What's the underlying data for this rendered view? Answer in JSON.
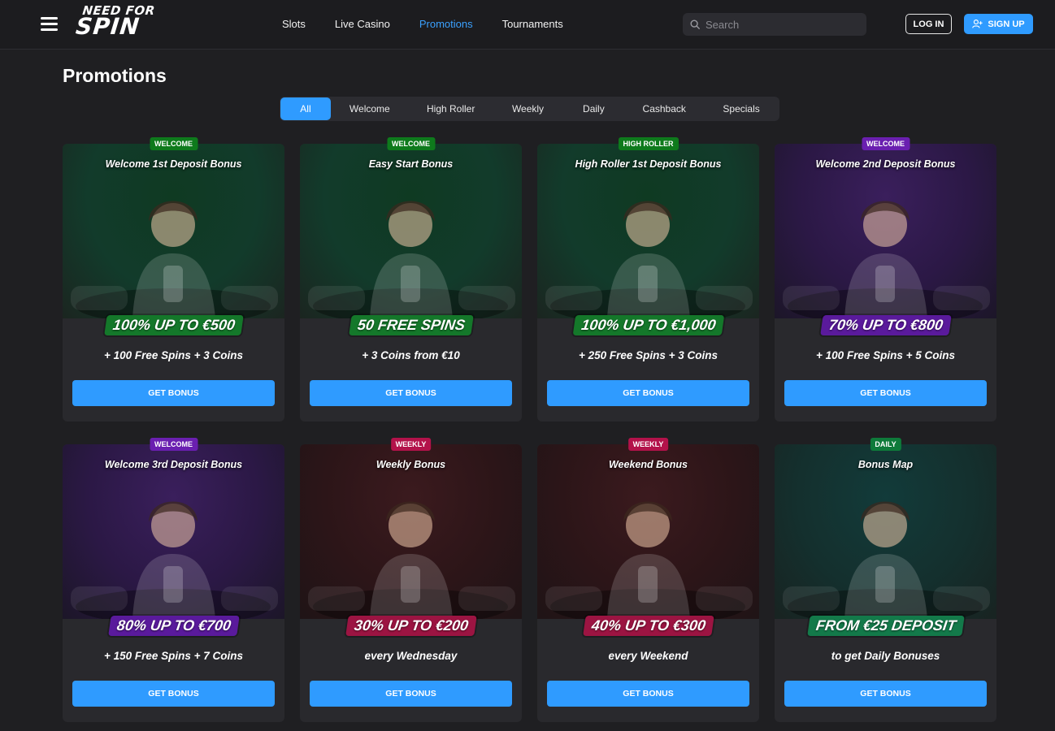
{
  "header": {
    "logo_line1": "NEED FOR",
    "logo_line2": "SPIN",
    "nav": [
      "Slots",
      "Live Casino",
      "Promotions",
      "Tournaments"
    ],
    "active_nav": "Promotions",
    "search_placeholder": "Search",
    "login_label": "LOG IN",
    "signup_label": "SIGN UP"
  },
  "page_title": "Promotions",
  "tabs": [
    "All",
    "Welcome",
    "High Roller",
    "Weekly",
    "Daily",
    "Cashback",
    "Specials"
  ],
  "active_tab": "All",
  "cards": [
    {
      "badge": "WELCOME",
      "badge_color": "#0e7a1c",
      "title": "Welcome 1st Deposit Bonus",
      "headline": "100% UP TO €500",
      "headline_color": "#14782a",
      "sub": "+ 100 Free Spins + 3 Coins",
      "cta": "GET BONUS",
      "theme": "green"
    },
    {
      "badge": "WELCOME",
      "badge_color": "#0e7a1c",
      "title": "Easy Start Bonus",
      "headline": "50 FREE SPINS",
      "headline_color": "#14782a",
      "sub": "+ 3 Coins from €10",
      "cta": "GET BONUS",
      "theme": "green"
    },
    {
      "badge": "HIGH ROLLER",
      "badge_color": "#0e7a1c",
      "title": "High Roller 1st Deposit Bonus",
      "headline": "100% UP TO €1,000",
      "headline_color": "#14782a",
      "sub": "+ 250 Free Spins + 3 Coins",
      "cta": "GET BONUS",
      "theme": "green"
    },
    {
      "badge": "WELCOME",
      "badge_color": "#6a1fb0",
      "title": "Welcome 2nd Deposit Bonus",
      "headline": "70% UP TO €800",
      "headline_color": "#5a1a9c",
      "sub": "+ 100 Free Spins + 5 Coins",
      "cta": "GET BONUS",
      "theme": "purple"
    },
    {
      "badge": "WELCOME",
      "badge_color": "#6a1fb0",
      "title": "Welcome 3rd Deposit Bonus",
      "headline": "80% UP TO €700",
      "headline_color": "#5a1a9c",
      "sub": "+ 150 Free Spins + 7 Coins",
      "cta": "GET BONUS",
      "theme": "purple"
    },
    {
      "badge": "WEEKLY",
      "badge_color": "#b3124a",
      "title": "Weekly Bonus",
      "headline": "30% UP TO €200",
      "headline_color": "#9c1442",
      "sub": "every Wednesday",
      "cta": "GET BONUS",
      "theme": "red"
    },
    {
      "badge": "WEEKLY",
      "badge_color": "#b3124a",
      "title": "Weekend Bonus",
      "headline": "40% UP TO €300",
      "headline_color": "#9c1442",
      "sub": "every Weekend",
      "cta": "GET BONUS",
      "theme": "red"
    },
    {
      "badge": "DAILY",
      "badge_color": "#0e7a3a",
      "title": "Bonus Map",
      "headline": "FROM €25 DEPOSIT",
      "headline_color": "#137a4a",
      "sub": "to get Daily Bonuses",
      "cta": "GET BONUS",
      "theme": "teal"
    }
  ],
  "colors": {
    "background": "#1f1f22",
    "card": "#29292d",
    "accent": "#2f9bff"
  }
}
